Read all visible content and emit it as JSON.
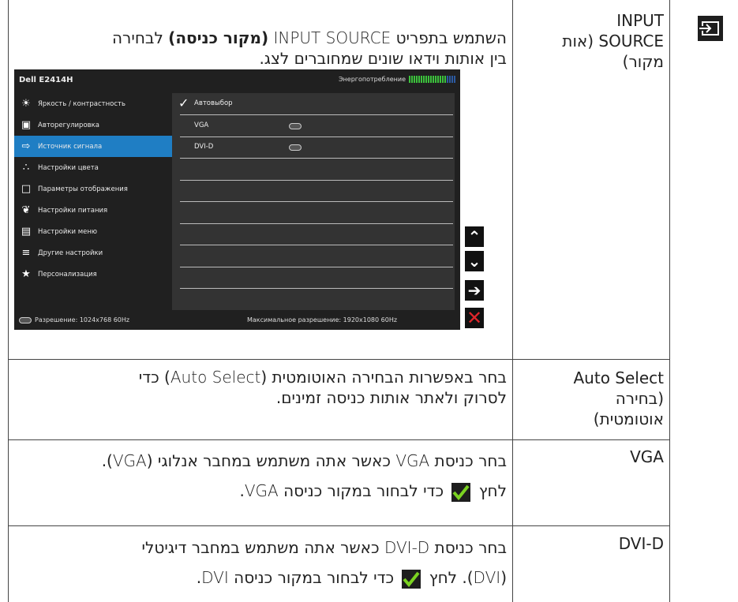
{
  "rows": [
    {
      "name": [
        "INPUT",
        "SOURCE (אות",
        "מקור)"
      ],
      "desc_lines": [
        [
          {
            "t": "השתמש בתפריט "
          },
          {
            "t": "INPUT SOURCE",
            "lat": true
          },
          {
            "t": " "
          },
          {
            "t": "(מקור כניסה)",
            "b": true
          },
          {
            "t": " לבחירה"
          }
        ],
        [
          {
            "t": "בין אותות וידאו שונים שמחוברים לצג."
          }
        ]
      ]
    },
    {
      "name": [
        "Auto Select",
        "(בחירה",
        "אוטומטית)"
      ],
      "desc_lines": [
        [
          {
            "t": "בחר באפשרות הבחירה האוטומטית ("
          },
          {
            "t": "Auto Select",
            "lat": true
          },
          {
            "t": ") כדי"
          }
        ],
        [
          {
            "t": "לסרוק ולאתר אותות כניסה זמינים."
          }
        ]
      ]
    },
    {
      "name": [
        "VGA"
      ],
      "desc_lines": [
        [
          {
            "t": "בחר כניסת "
          },
          {
            "t": "VGA",
            "lat": true
          },
          {
            "t": " כאשר אתה משתמש במחבר אנלוגי ("
          },
          {
            "t": "VGA",
            "lat": true
          },
          {
            "t": ")."
          }
        ],
        [
          {
            "t": "לחץ "
          },
          {
            "check": true
          },
          {
            "t": " כדי לבחור במקור כניסה "
          },
          {
            "t": "VGA",
            "lat": true
          },
          {
            "t": "."
          }
        ]
      ]
    },
    {
      "name": [
        "DVI-D"
      ],
      "desc_lines": [
        [
          {
            "t": "בחר כניסת "
          },
          {
            "t": "DVI-D",
            "lat": true
          },
          {
            "t": " כאשר אתה משתמש במחבר דיגיטלי"
          }
        ],
        [
          {
            "t": "("
          },
          {
            "t": "DVI",
            "lat": true
          },
          {
            "t": "). לחץ "
          },
          {
            "check": true
          },
          {
            "t": " כדי לבחור במקור כניסה "
          },
          {
            "t": "DVI",
            "lat": true
          },
          {
            "t": "."
          }
        ]
      ]
    }
  ],
  "osd": {
    "model": "Dell E2414H",
    "energy_label": "Энергопотребление",
    "energy_level": 0.8,
    "menu": [
      {
        "label": "Яркость / контрастность",
        "icon": "brightness-icon"
      },
      {
        "label": "Авторегулировка",
        "icon": "auto-adjust-icon"
      },
      {
        "label": "Источник сигнала",
        "icon": "input-source-icon",
        "selected": true
      },
      {
        "label": "Настройки цвета",
        "icon": "color-icon"
      },
      {
        "label": "Параметры отображения",
        "icon": "display-icon"
      },
      {
        "label": "Настройки питания",
        "icon": "energy-icon"
      },
      {
        "label": "Настройки меню",
        "icon": "menu-icon"
      },
      {
        "label": "Другие настройки",
        "icon": "other-settings-icon"
      },
      {
        "label": "Персонализация",
        "icon": "star-icon"
      }
    ],
    "options": [
      {
        "label": "Автовыбор",
        "checked": true
      },
      {
        "label": "VGA",
        "connector": "vga-connector-icon"
      },
      {
        "label": "DVI-D",
        "connector": "dvi-connector-icon"
      }
    ],
    "footer_left": "Разрешение: 1024x768 60Hz",
    "footer_right": "Максимальное разрешение: 1920x1080 60Hz",
    "buttons": [
      "up-arrow-icon",
      "down-arrow-icon",
      "right-arrow-icon",
      "close-icon"
    ]
  }
}
